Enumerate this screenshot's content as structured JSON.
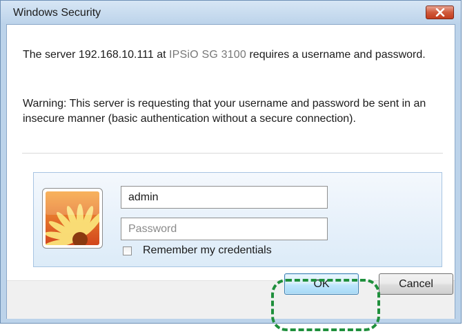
{
  "window": {
    "title": "Windows Security",
    "close_symbol": "✕"
  },
  "message": {
    "prefix": "The server",
    "server_ip": "192.168.10.111",
    "at": "at",
    "device_name": "IPSiO SG 3100",
    "suffix": "requires a username and password.",
    "warning": "Warning: This server is requesting that your username and password be sent in an insecure manner (basic authentication without a secure connection)."
  },
  "credentials": {
    "avatar_icon": "flower-user-tile-icon",
    "username_value": "admin",
    "password_placeholder": "Password",
    "remember_label": "Remember my credentials",
    "remember_checked": false
  },
  "buttons": {
    "ok_label": "OK",
    "cancel_label": "Cancel"
  },
  "colors": {
    "highlight": "#1f8f3c",
    "close_button": "#c9472a",
    "frame": "#bcd3ea"
  }
}
